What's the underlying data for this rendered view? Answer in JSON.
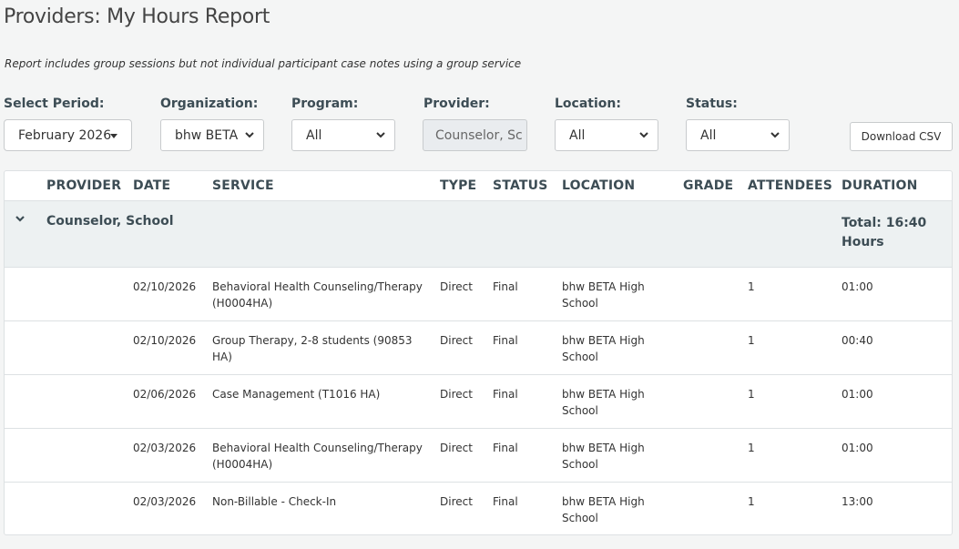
{
  "page": {
    "title": "Providers: My Hours Report",
    "note": "Report includes group sessions but not individual participant case notes using a group service"
  },
  "filters": {
    "period": {
      "label": "Select Period:",
      "value": "February 2026"
    },
    "organization": {
      "label": "Organization:",
      "value": "bhw BETA"
    },
    "program": {
      "label": "Program:",
      "value": "All"
    },
    "provider": {
      "label": "Provider:",
      "value": "Counselor, Sc"
    },
    "location": {
      "label": "Location:",
      "value": "All"
    },
    "status": {
      "label": "Status:",
      "value": "All"
    }
  },
  "download_label": "Download CSV",
  "table": {
    "headers": {
      "provider": "PROVIDER",
      "date": "DATE",
      "service": "SERVICE",
      "type": "TYPE",
      "status": "STATUS",
      "location": "LOCATION",
      "grade": "GRADE",
      "attendees": "ATTENDEES",
      "duration": "DURATION"
    },
    "group": {
      "name": "Counselor, School",
      "total": "Total: 16:40 Hours"
    },
    "rows": [
      {
        "date": "02/10/2026",
        "service": "Behavioral Health Counseling/Therapy (H0004HA)",
        "type": "Direct",
        "status": "Final",
        "location": "bhw BETA High School",
        "grade": "",
        "attendees": "1",
        "duration": "01:00"
      },
      {
        "date": "02/10/2026",
        "service": "Group Therapy, 2-8 students (90853 HA)",
        "type": "Direct",
        "status": "Final",
        "location": "bhw BETA High School",
        "grade": "",
        "attendees": "1",
        "duration": "00:40"
      },
      {
        "date": "02/06/2026",
        "service": "Case Management (T1016 HA)",
        "type": "Direct",
        "status": "Final",
        "location": "bhw BETA High School",
        "grade": "",
        "attendees": "1",
        "duration": "01:00"
      },
      {
        "date": "02/03/2026",
        "service": "Behavioral Health Counseling/Therapy (H0004HA)",
        "type": "Direct",
        "status": "Final",
        "location": "bhw BETA High School",
        "grade": "",
        "attendees": "1",
        "duration": "01:00"
      },
      {
        "date": "02/03/2026",
        "service": "Non-Billable - Check-In",
        "type": "Direct",
        "status": "Final",
        "location": "bhw BETA High School",
        "grade": "",
        "attendees": "1",
        "duration": "13:00"
      }
    ]
  },
  "colors": {
    "header_text": "#3d4d55",
    "group_bg": "#edf1f2",
    "border": "#dde1e3"
  }
}
